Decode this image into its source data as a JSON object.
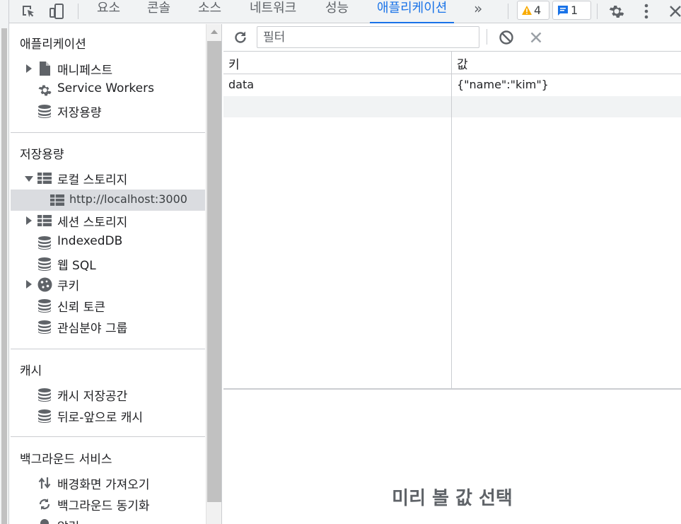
{
  "toolbar": {
    "tabs": [
      "요소",
      "콘솔",
      "소스",
      "네트워크",
      "성능",
      "애플리케이션"
    ],
    "active_tab": "애플리케이션",
    "more_tabs_label": "»",
    "warning_count": "4",
    "message_count": "1",
    "accent_color": "#1a73e8"
  },
  "sidebar": {
    "application": {
      "title": "애플리케이션",
      "items": [
        "매니페스트",
        "Service Workers",
        "저장용량"
      ]
    },
    "storage": {
      "title": "저장용량",
      "local_storage": "로컬 스토리지",
      "local_origin": "http://localhost:3000",
      "session_storage": "세션 스토리지",
      "indexeddb": "IndexedDB",
      "websql": "웹 SQL",
      "cookies": "쿠키",
      "trust_tokens": "신뢰 토큰",
      "interest_groups": "관심분야 그룹"
    },
    "cache": {
      "title": "캐시",
      "items": [
        "캐시 저장공간",
        "뒤로-앞으로 캐시"
      ]
    },
    "background": {
      "title": "백그라운드 서비스",
      "items": [
        "배경화면 가져오기",
        "백그라운드 동기화",
        "알림"
      ]
    }
  },
  "main": {
    "filter_placeholder": "필터",
    "columns": {
      "key": "키",
      "value": "값"
    },
    "rows": [
      {
        "key": "data",
        "value": "{\"name\":\"kim\"}"
      }
    ],
    "preview_text": "미리 볼 값 선택"
  }
}
